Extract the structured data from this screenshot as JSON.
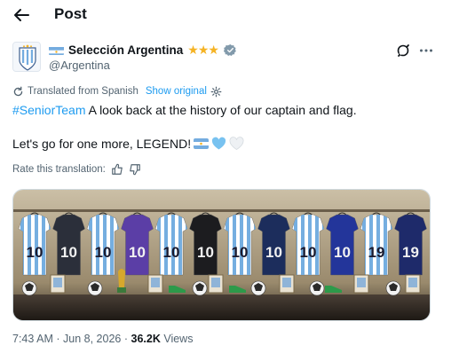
{
  "header": {
    "title": "Post"
  },
  "author": {
    "display_name": "Selección Argentina",
    "stars": "★★★",
    "handle": "@Argentina"
  },
  "translation": {
    "label": "Translated from Spanish",
    "show_original": "Show original",
    "rate_label": "Rate this translation:"
  },
  "tweet": {
    "hashtag": "#SeniorTeam",
    "line1_rest": " A look back at the history of our captain and flag.",
    "line2": "Let's go for one more, LEGEND!"
  },
  "media": {
    "jerseys": [
      {
        "number": "10",
        "body": "stripes",
        "bg": "#ffffff"
      },
      {
        "number": "10",
        "body": "solid",
        "bg": "#2b2f3a"
      },
      {
        "number": "10",
        "body": "stripes",
        "bg": "#ffffff"
      },
      {
        "number": "10",
        "body": "solid",
        "bg": "#5b3ea6"
      },
      {
        "number": "10",
        "body": "stripes",
        "bg": "#ffffff"
      },
      {
        "number": "10",
        "body": "solid",
        "bg": "#1c1c1f"
      },
      {
        "number": "10",
        "body": "stripes",
        "bg": "#ffffff"
      },
      {
        "number": "10",
        "body": "solid",
        "bg": "#1c2d5c"
      },
      {
        "number": "10",
        "body": "stripes",
        "bg": "#ffffff"
      },
      {
        "number": "10",
        "body": "solid",
        "bg": "#23359a"
      },
      {
        "number": "19",
        "body": "stripes",
        "bg": "#ffffff"
      },
      {
        "number": "19",
        "body": "solid",
        "bg": "#1e2a6a"
      }
    ]
  },
  "meta": {
    "time": "7:43 AM",
    "date": "Jun 8, 2026",
    "views_count": "36.2K",
    "views_label": "Views",
    "separator": "·"
  },
  "colors": {
    "accent": "#1d9bf0",
    "secondary_text": "#536471",
    "argentina_blue": "#74acdf",
    "star_gold": "#f5b324"
  },
  "icons": [
    "back-arrow-icon",
    "verified-badge-icon",
    "grok-icon",
    "more-icon",
    "translate-icon",
    "gear-icon",
    "thumbs-up-icon",
    "thumbs-down-icon"
  ]
}
